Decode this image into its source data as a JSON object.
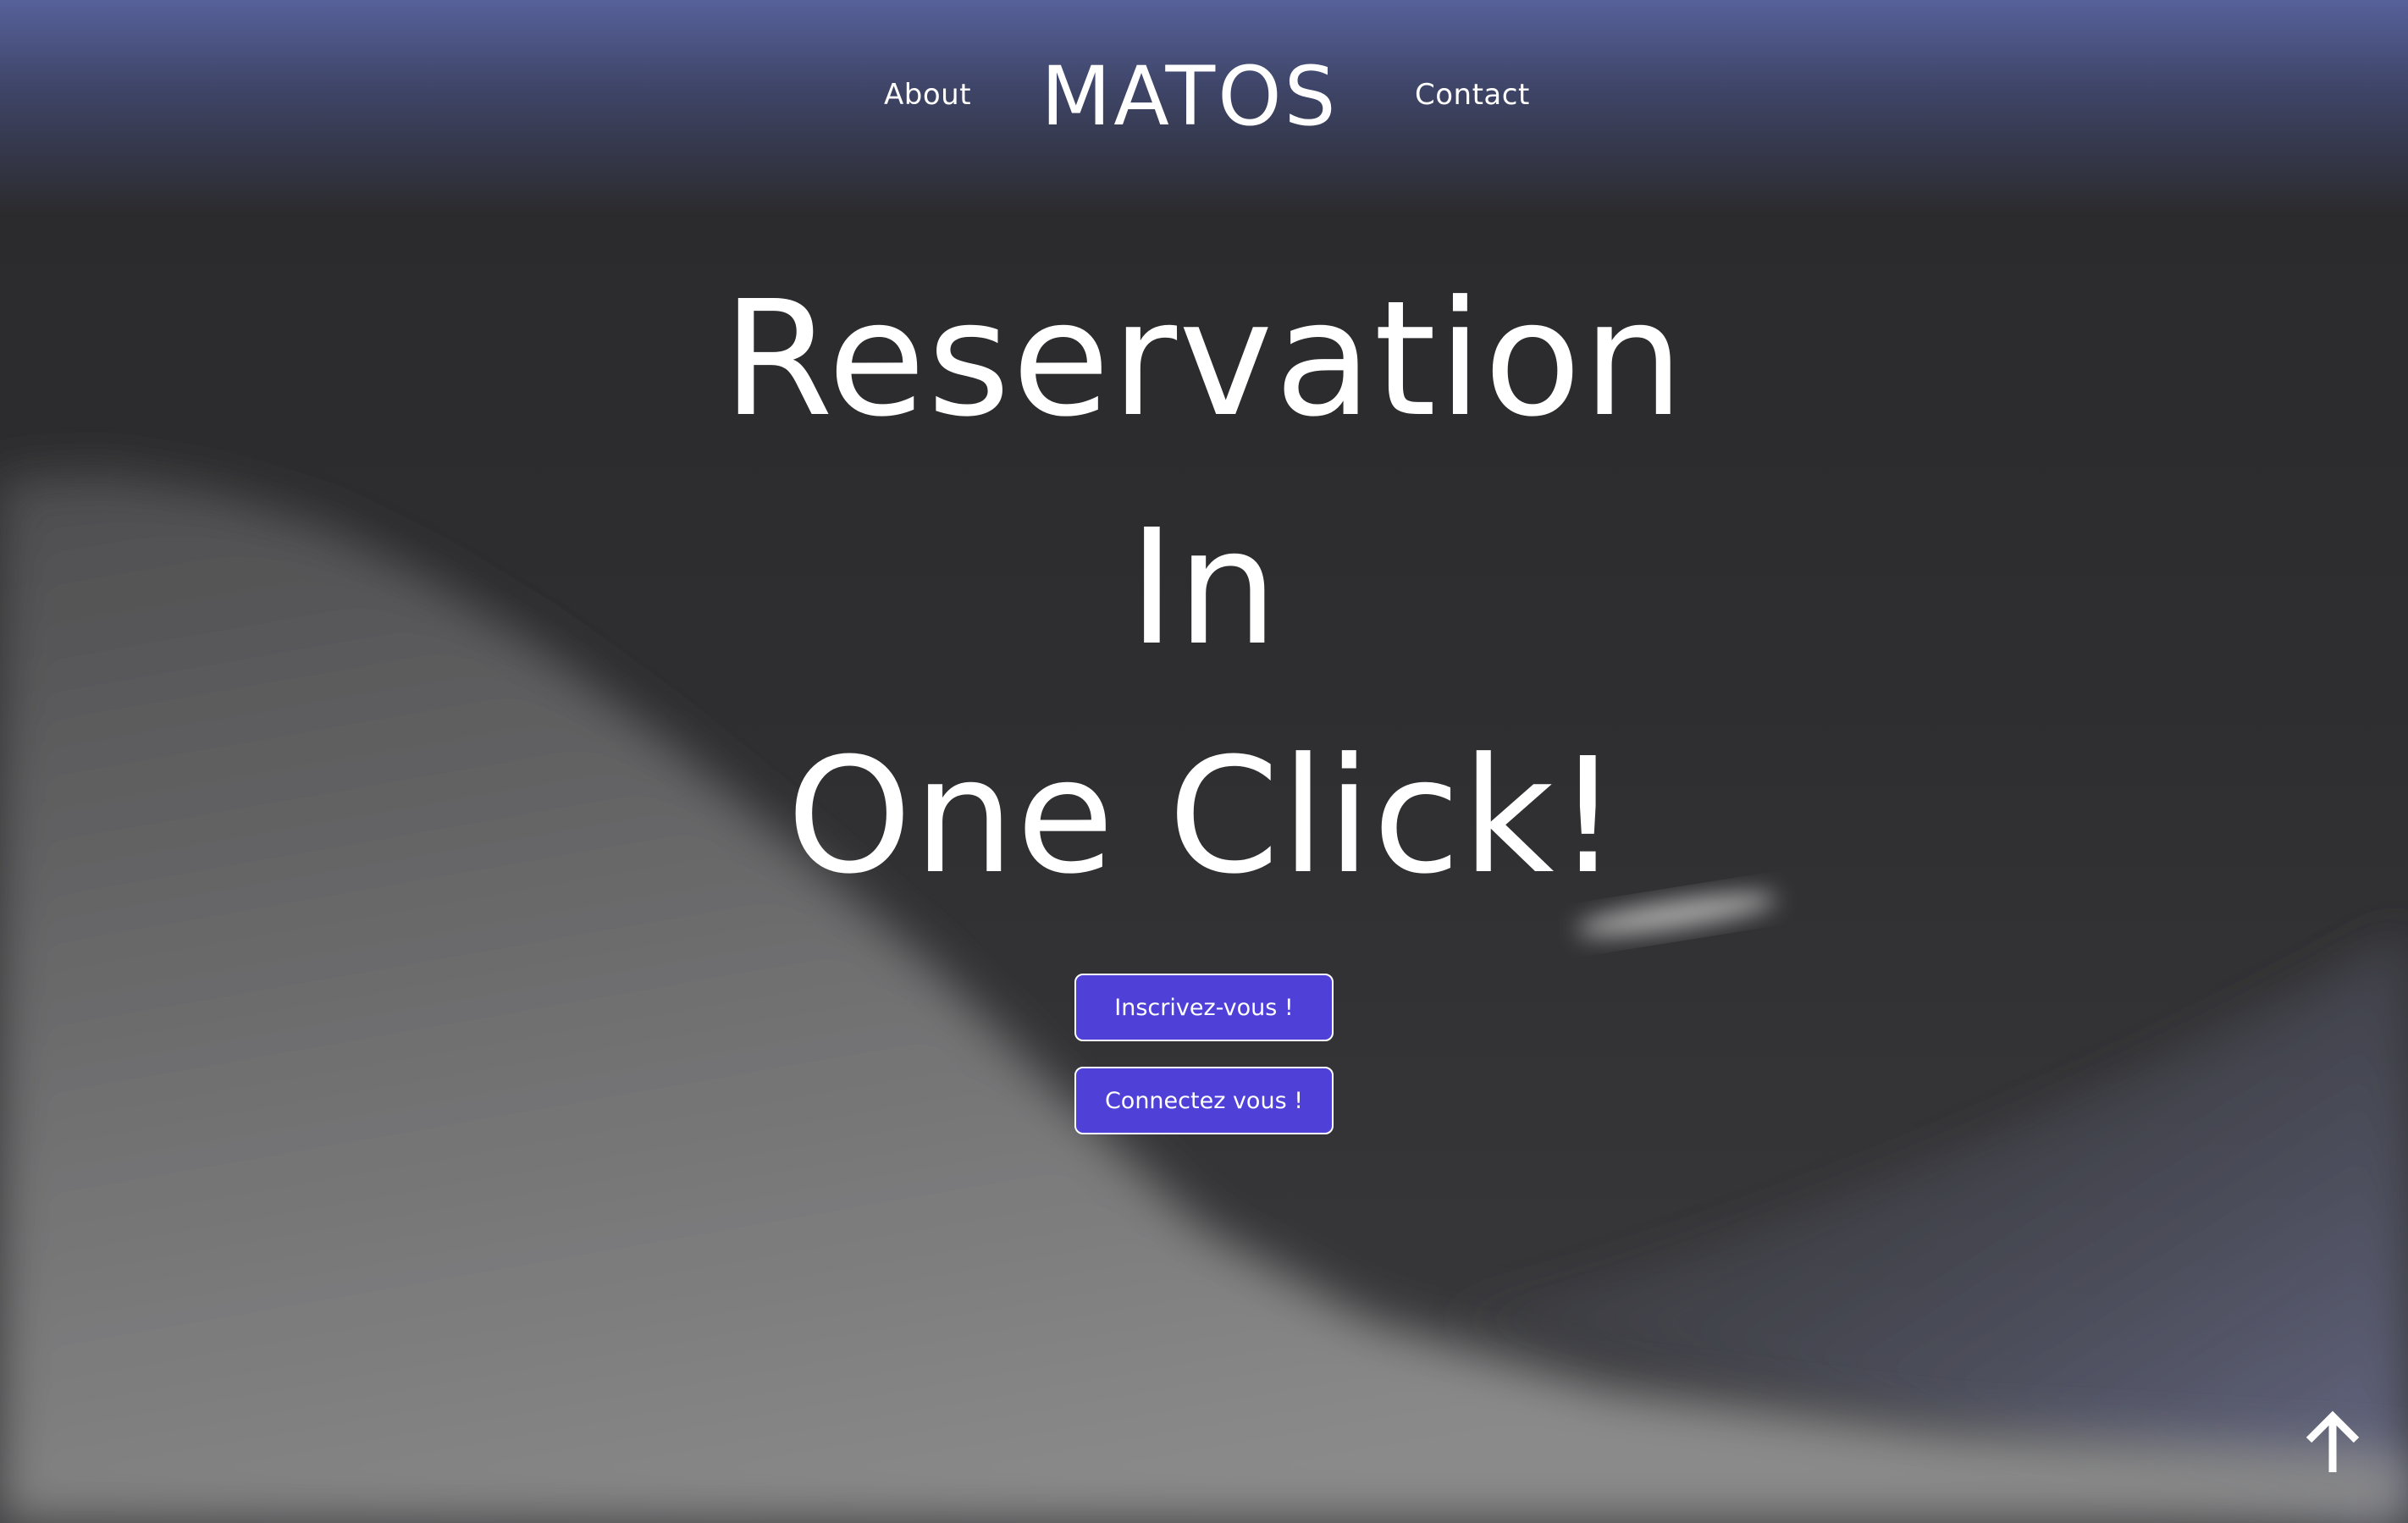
{
  "header": {
    "brand": "MATOS",
    "nav": {
      "about_label": "About",
      "contact_label": "Contact"
    }
  },
  "hero": {
    "lines": [
      "Reservation",
      "In",
      "One Click!"
    ]
  },
  "actions": {
    "signup_label": "Inscrivez-vous !",
    "login_label": "Connectez vous !"
  },
  "scroll_top": {
    "icon": "arrow-up-icon"
  },
  "colors": {
    "accent": "#4f41d8",
    "background_dark": "#2c2c2e",
    "background_gradient_top": "#56619a",
    "hill_light": "#8a8a8a",
    "text": "#ffffff"
  }
}
